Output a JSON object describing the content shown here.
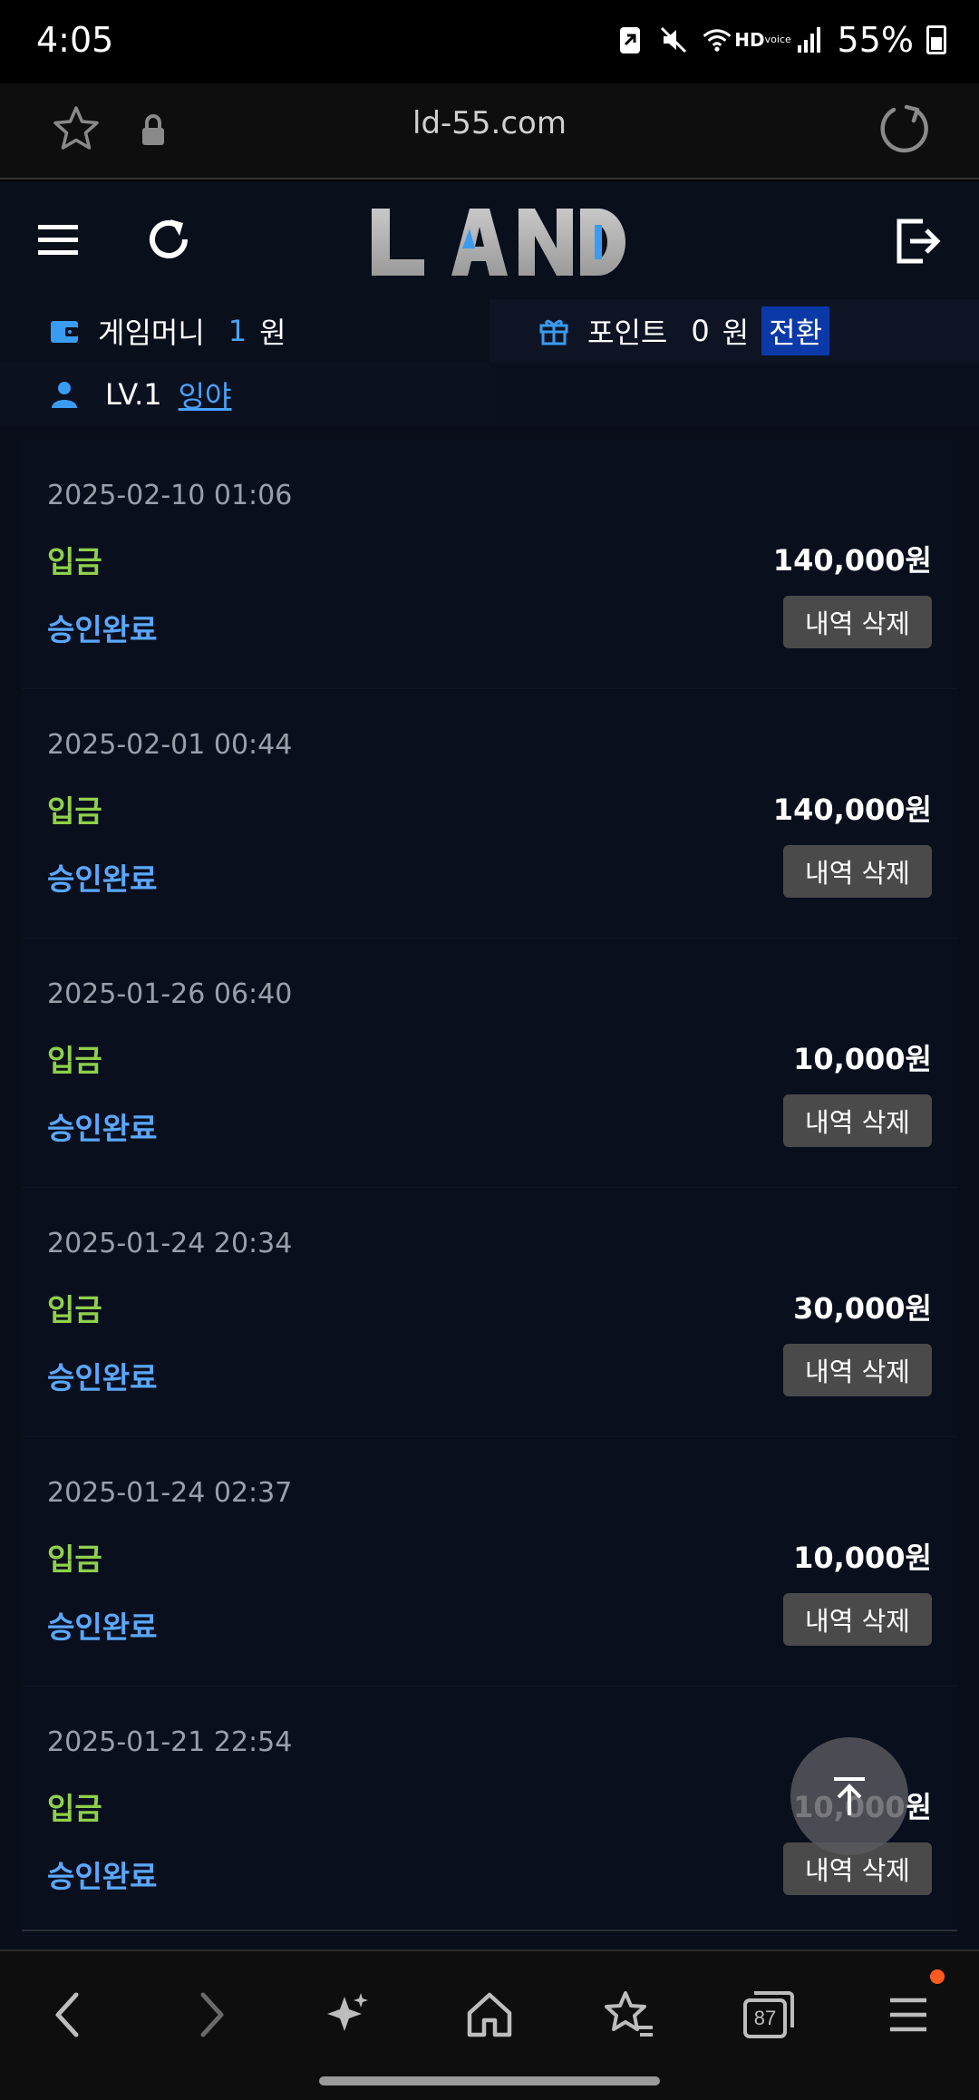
{
  "status_bar": {
    "time": "4:05",
    "hd_label": "HD",
    "hd_sub": "voice",
    "battery_percent": "55%"
  },
  "browser": {
    "url": "ld-55.com",
    "tab_count": "87"
  },
  "site": {
    "logo_text": "LAND",
    "accent_color": "#4aa3ff"
  },
  "account": {
    "game_money_label": "게임머니",
    "game_money_value": "1",
    "game_money_unit": "원",
    "point_label": "포인트",
    "point_value": "0",
    "point_unit": "원",
    "convert_label": "전환",
    "level": "LV.1",
    "nickname": "잉야"
  },
  "transactions": [
    {
      "date": "2025-02-10 01:06",
      "type": "입금",
      "amount": "140,000원",
      "status": "승인완료",
      "delete_label": "내역 삭제"
    },
    {
      "date": "2025-02-01 00:44",
      "type": "입금",
      "amount": "140,000원",
      "status": "승인완료",
      "delete_label": "내역 삭제"
    },
    {
      "date": "2025-01-26 06:40",
      "type": "입금",
      "amount": "10,000원",
      "status": "승인완료",
      "delete_label": "내역 삭제"
    },
    {
      "date": "2025-01-24 20:34",
      "type": "입금",
      "amount": "30,000원",
      "status": "승인완료",
      "delete_label": "내역 삭제"
    },
    {
      "date": "2025-01-24 02:37",
      "type": "입금",
      "amount": "10,000원",
      "status": "승인완료",
      "delete_label": "내역 삭제"
    },
    {
      "date": "2025-01-21 22:54",
      "type": "입금",
      "amount": "10,000원",
      "status": "승인완료",
      "delete_label": "내역 삭제"
    }
  ]
}
